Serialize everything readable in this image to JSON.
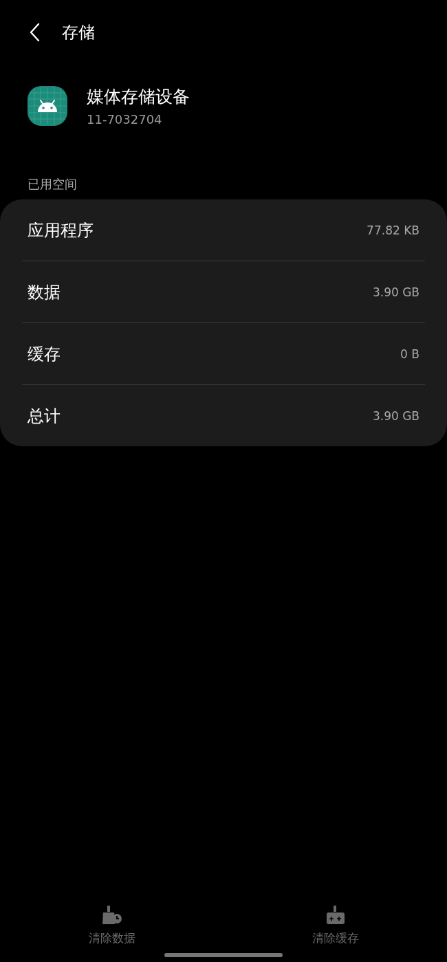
{
  "header": {
    "title": "存储"
  },
  "app": {
    "name": "媒体存储设备",
    "version": "11-7032704"
  },
  "section": {
    "title": "已用空间"
  },
  "rows": [
    {
      "label": "应用程序",
      "value": "77.82 KB"
    },
    {
      "label": "数据",
      "value": "3.90 GB"
    },
    {
      "label": "缓存",
      "value": "0 B"
    },
    {
      "label": "总计",
      "value": "3.90 GB"
    }
  ],
  "actions": [
    {
      "kind": "clear-data",
      "label": "清除数据",
      "disabled": true
    },
    {
      "kind": "clear-cache",
      "label": "清除缓存",
      "disabled": true
    }
  ]
}
